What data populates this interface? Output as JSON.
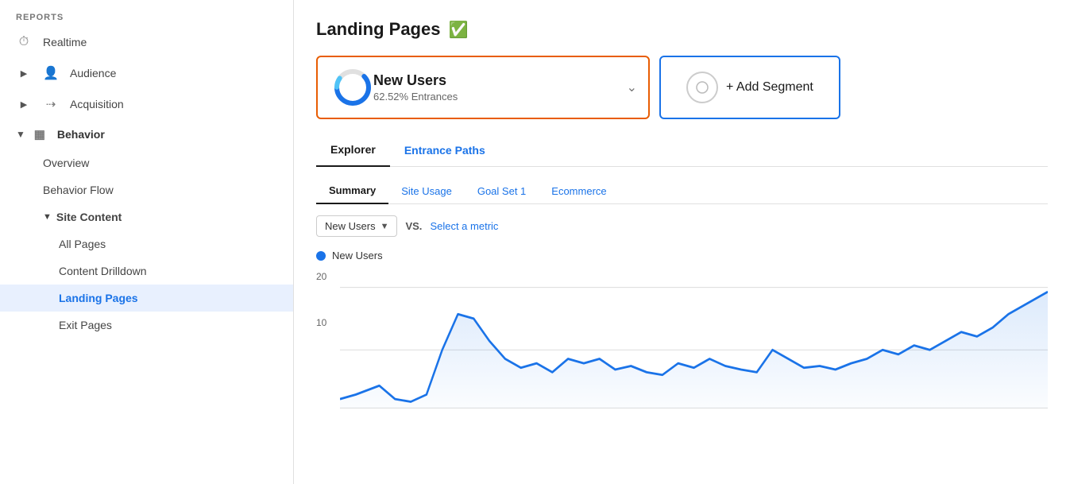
{
  "sidebar": {
    "reports_label": "REPORTS",
    "items": [
      {
        "id": "realtime",
        "label": "Realtime",
        "icon": "⏱",
        "type": "top"
      },
      {
        "id": "audience",
        "label": "Audience",
        "icon": "👤",
        "type": "top",
        "expandable": true
      },
      {
        "id": "acquisition",
        "label": "Acquisition",
        "icon": "✦",
        "type": "top",
        "expandable": true
      },
      {
        "id": "behavior",
        "label": "Behavior",
        "icon": "▦",
        "type": "top",
        "expanded": true
      },
      {
        "id": "overview",
        "label": "Overview",
        "type": "sub"
      },
      {
        "id": "behavior-flow",
        "label": "Behavior Flow",
        "type": "sub"
      },
      {
        "id": "site-content",
        "label": "Site Content",
        "type": "sub",
        "expandable": true,
        "expanded": true
      },
      {
        "id": "all-pages",
        "label": "All Pages",
        "type": "subsub"
      },
      {
        "id": "content-drilldown",
        "label": "Content Drilldown",
        "type": "subsub"
      },
      {
        "id": "landing-pages",
        "label": "Landing Pages",
        "type": "subsub",
        "active": true
      },
      {
        "id": "exit-pages",
        "label": "Exit Pages",
        "type": "subsub"
      }
    ]
  },
  "page": {
    "title": "Landing Pages",
    "shield_icon": "🛡"
  },
  "segment": {
    "name": "New Users",
    "sub": "62.52% Entrances",
    "border_color": "#e85d04"
  },
  "add_segment": {
    "label": "+ Add Segment",
    "border_color": "#1a73e8"
  },
  "tabs": [
    {
      "id": "explorer",
      "label": "Explorer",
      "active": true
    },
    {
      "id": "entrance-paths",
      "label": "Entrance Paths",
      "active": false,
      "blue": true
    }
  ],
  "sub_tabs": [
    {
      "id": "summary",
      "label": "Summary",
      "active": true
    },
    {
      "id": "site-usage",
      "label": "Site Usage",
      "link": true
    },
    {
      "id": "goal-set",
      "label": "Goal Set 1",
      "link": true
    },
    {
      "id": "ecommerce",
      "label": "Ecommerce",
      "link": true
    }
  ],
  "metric_selector": {
    "selected": "New Users",
    "vs_label": "VS.",
    "select_prompt": "Select a metric"
  },
  "chart": {
    "legend_label": "New Users",
    "y_labels": [
      "20",
      "10"
    ],
    "color": "#1a73e8"
  }
}
